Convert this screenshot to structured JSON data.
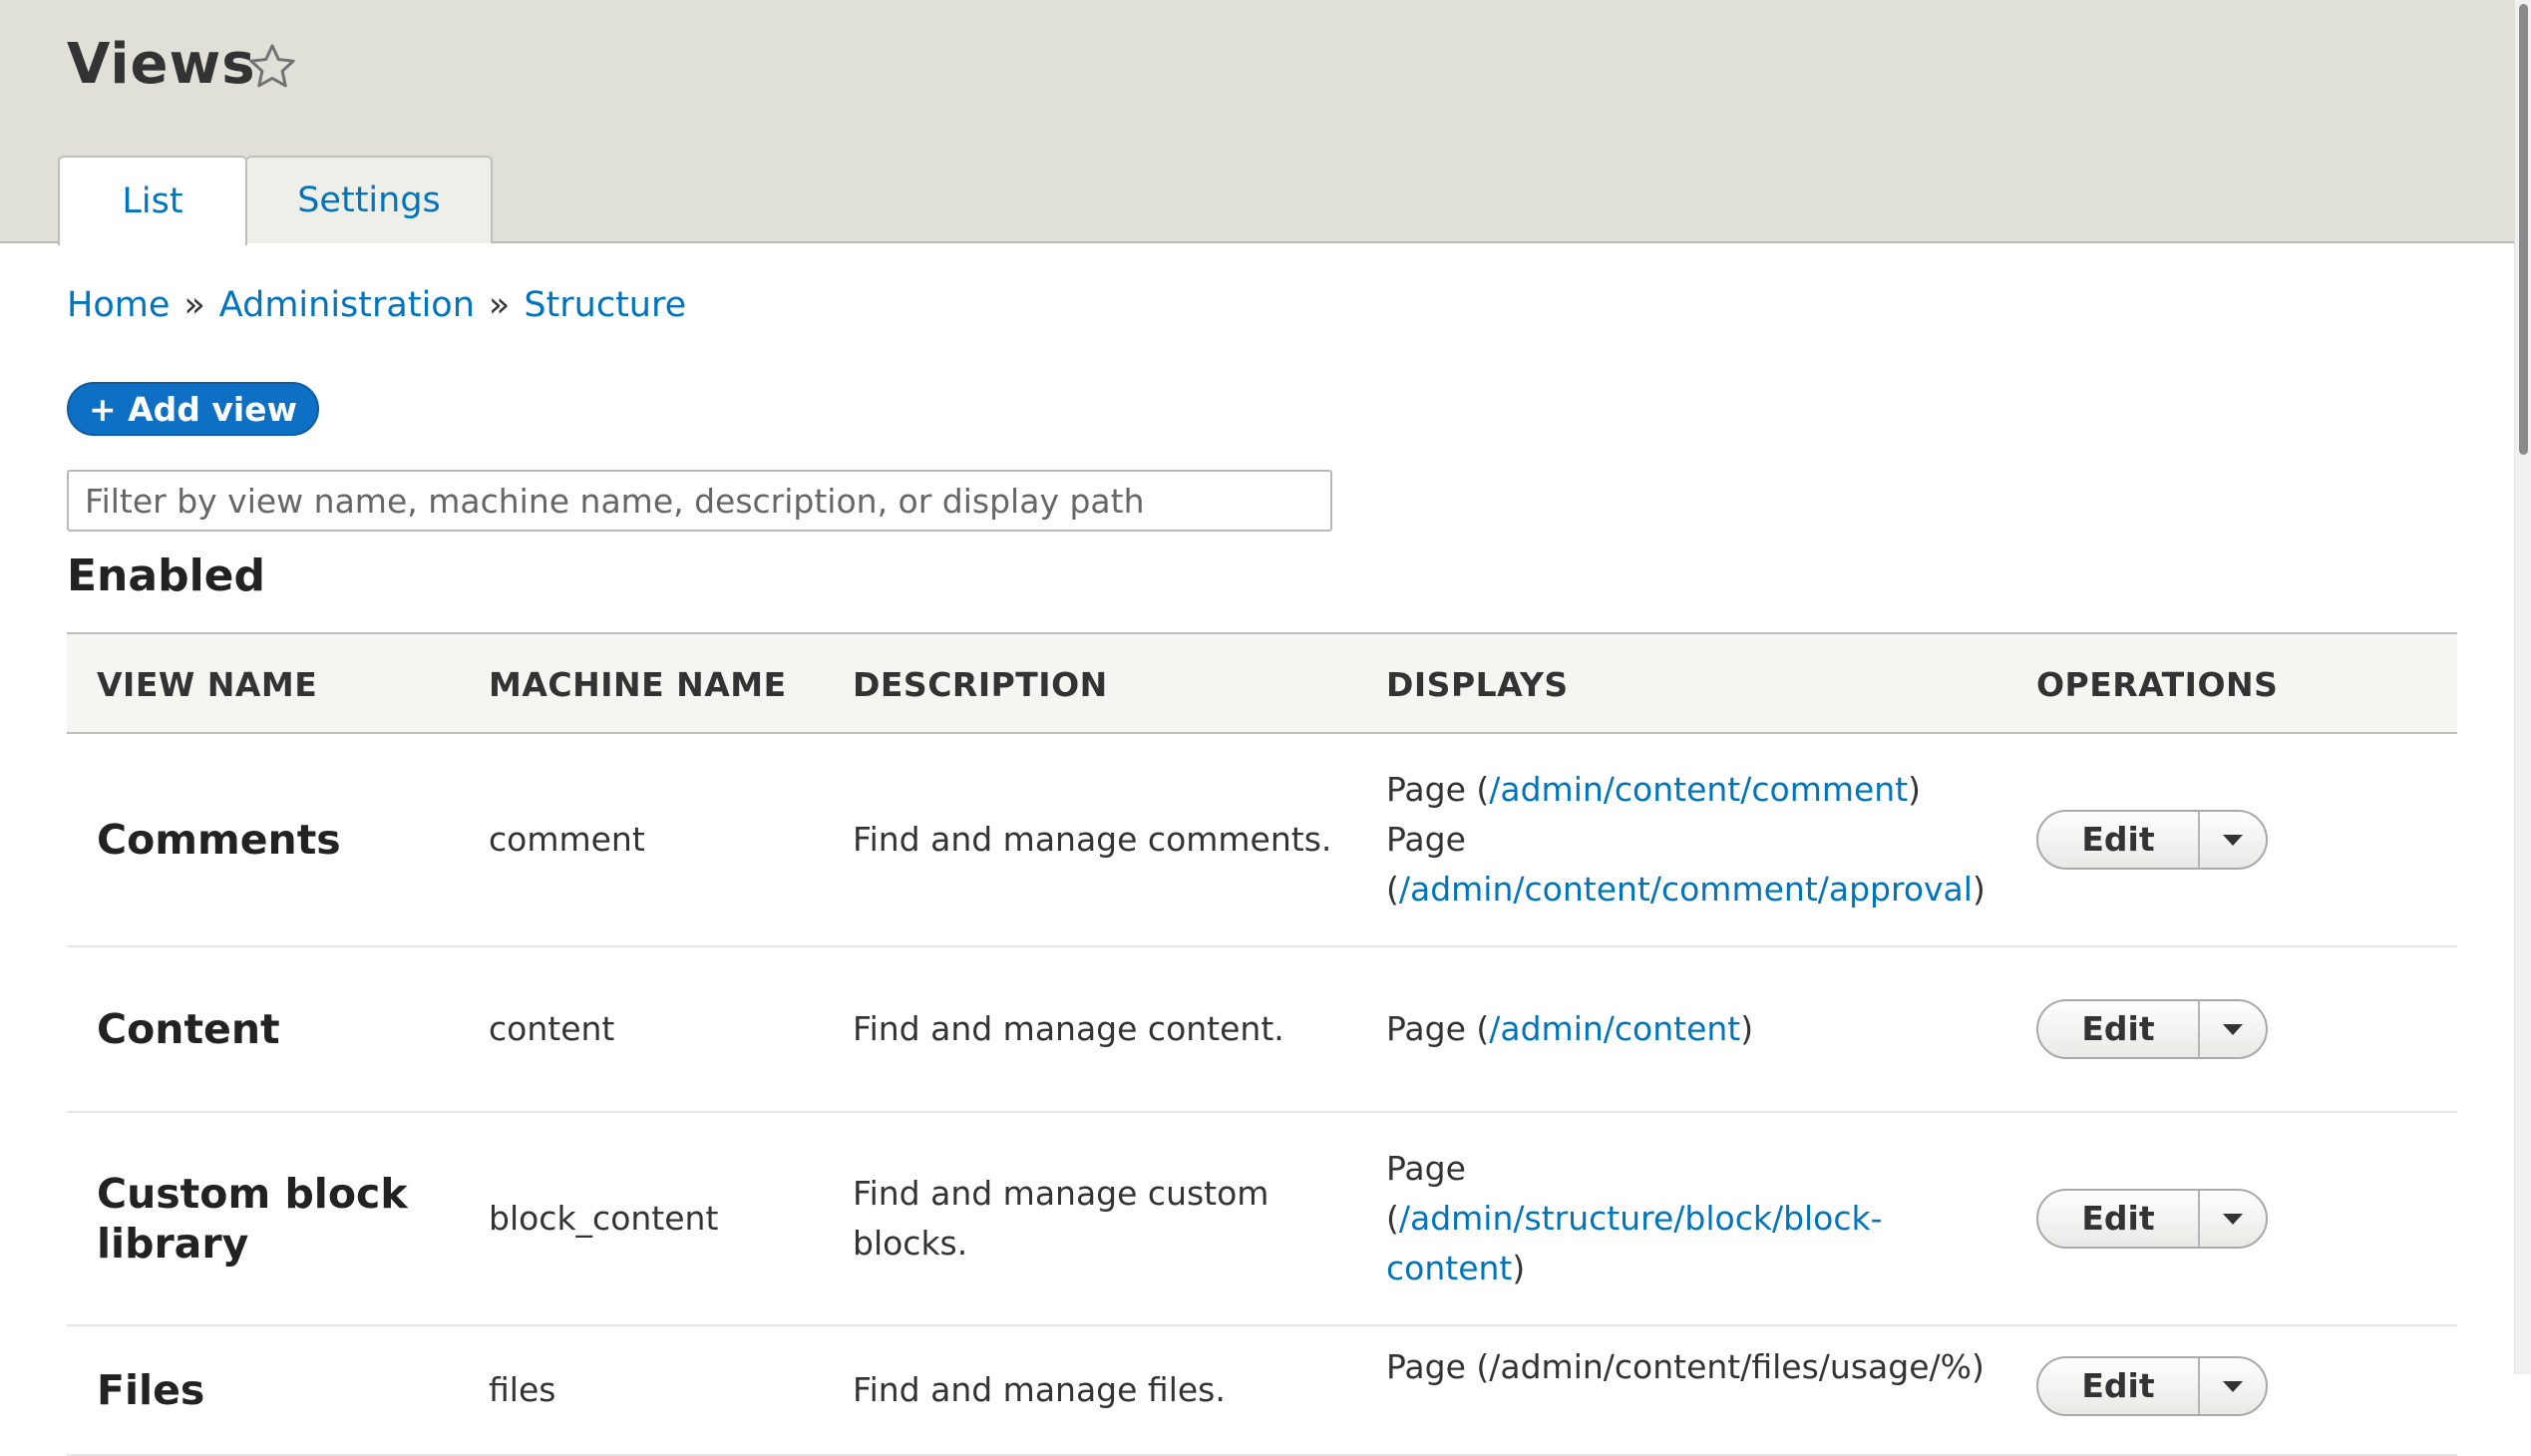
{
  "header": {
    "title": "Views",
    "star_icon": "star-outline-icon",
    "tabs": [
      {
        "label": "List",
        "active": true
      },
      {
        "label": "Settings",
        "active": false
      }
    ]
  },
  "breadcrumb": {
    "items": [
      "Home",
      "Administration",
      "Structure"
    ],
    "separator": "»"
  },
  "actions": {
    "add_view_label": "+ Add view"
  },
  "filter": {
    "placeholder": "Filter by view name, machine name, description, or display path",
    "value": ""
  },
  "section": {
    "heading": "Enabled"
  },
  "table": {
    "headers": [
      "VIEW NAME",
      "MACHINE NAME",
      "DESCRIPTION",
      "DISPLAYS",
      "OPERATIONS"
    ],
    "edit_label": "Edit",
    "rows": [
      {
        "name_lines": [
          "Comments"
        ],
        "machine": "comment",
        "description_lines": [
          "Find and manage comments."
        ],
        "displays": [
          {
            "prefix": "Page (",
            "link": "/admin/content/comment",
            "suffix": ")"
          },
          {
            "prefix": "Page",
            "link": "",
            "suffix": ""
          },
          {
            "prefix": "(",
            "link": "/admin/content/comment/approval",
            "suffix": ")"
          }
        ]
      },
      {
        "name_lines": [
          "Content"
        ],
        "machine": "content",
        "description_lines": [
          "Find and manage content."
        ],
        "displays": [
          {
            "prefix": "Page (",
            "link": "/admin/content",
            "suffix": ")"
          }
        ]
      },
      {
        "name_lines": [
          "Custom block",
          "library"
        ],
        "machine": "block_content",
        "description_lines": [
          "Find and manage custom",
          "blocks."
        ],
        "displays": [
          {
            "prefix": "Page",
            "link": "",
            "suffix": ""
          },
          {
            "prefix": "(",
            "link": "/admin/structure/block/block-",
            "suffix": ""
          },
          {
            "prefix": "",
            "link": "content",
            "suffix": ")"
          }
        ]
      },
      {
        "name_lines": [
          "Files"
        ],
        "machine": "files",
        "description_lines": [
          "Find and manage files."
        ],
        "displays": [
          {
            "prefix": "Page (/admin/content/files/usage/%)",
            "link": "",
            "suffix": ""
          }
        ]
      }
    ]
  },
  "colors": {
    "header_bg": "#e0e0d8",
    "link": "#0074bd",
    "primary_button": "#0d70c4",
    "table_header_bg": "#f5f5f2"
  }
}
